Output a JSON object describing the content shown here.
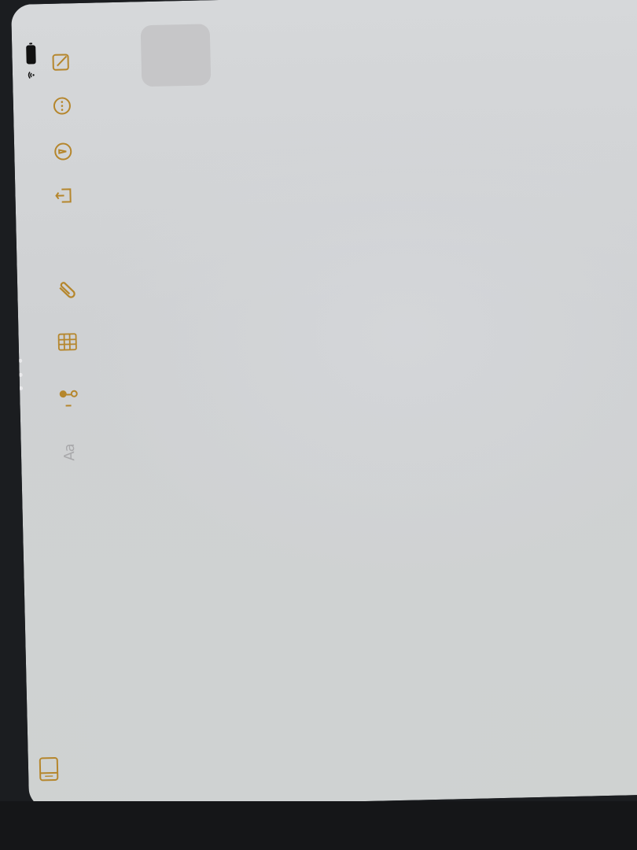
{
  "device": {
    "battery_icon": "battery-full-icon",
    "wifi_icon": "wifi-icon"
  },
  "toolbar": {
    "accent_color": "#b5862c",
    "items": [
      {
        "name": "new-note",
        "icon": "square-pencil-icon"
      },
      {
        "name": "more",
        "icon": "ellipsis-circle-icon"
      },
      {
        "name": "markup",
        "icon": "pen-tip-circle-icon"
      },
      {
        "name": "share",
        "icon": "share-icon"
      },
      {
        "name": "attach",
        "icon": "paperclip-icon"
      },
      {
        "name": "table",
        "icon": "table-icon"
      },
      {
        "name": "checklist",
        "icon": "checklist-icon"
      },
      {
        "name": "format",
        "icon": "text-format-icon",
        "label": "Aa"
      }
    ]
  },
  "sidebar_toggle": {
    "icon": "sidebar-icon"
  },
  "note": {
    "body": ""
  }
}
